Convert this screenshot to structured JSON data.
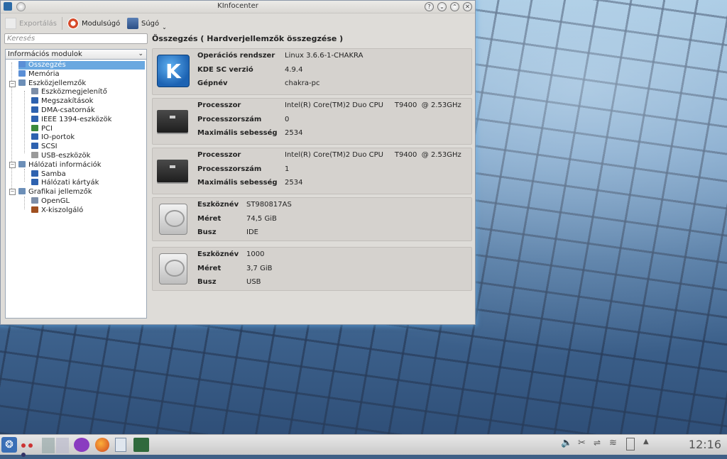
{
  "window": {
    "title": "KInfocenter"
  },
  "toolbar": {
    "export_label": "Exportálás",
    "module_help_label": "Modulsúgó",
    "help_label": "Súgó"
  },
  "search": {
    "placeholder": "Keresés"
  },
  "modules": {
    "combo_label": "Információs modulok",
    "items": [
      {
        "label": "Összegzés",
        "level": 1,
        "icon_color": "#5b8fd6"
      },
      {
        "label": "Memória",
        "level": 1,
        "icon_color": "#5b8fd6"
      },
      {
        "label": "Eszközjellemzők",
        "level": 1,
        "icon_color": "#6c8fb8"
      },
      {
        "label": "Eszközmegjelenítő",
        "level": 2,
        "icon_color": "#7d8ea8"
      },
      {
        "label": "Megszakítások",
        "level": 2,
        "icon_color": "#2e62b0"
      },
      {
        "label": "DMA-csatornák",
        "level": 2,
        "icon_color": "#2e62b0"
      },
      {
        "label": "IEEE 1394-eszközök",
        "level": 2,
        "icon_color": "#2e62b0"
      },
      {
        "label": "PCI",
        "level": 2,
        "icon_color": "#3c8a3c"
      },
      {
        "label": "IO-portok",
        "level": 2,
        "icon_color": "#2e62b0"
      },
      {
        "label": "SCSI",
        "level": 2,
        "icon_color": "#2e62b0"
      },
      {
        "label": "USB-eszközök",
        "level": 2,
        "icon_color": "#9a9a9a"
      },
      {
        "label": "Hálózati információk",
        "level": 1,
        "icon_color": "#6c8fb8"
      },
      {
        "label": "Samba",
        "level": 2,
        "icon_color": "#2e62b0"
      },
      {
        "label": "Hálózati kártyák",
        "level": 2,
        "icon_color": "#2e62b0"
      },
      {
        "label": "Grafikai jellemzők",
        "level": 1,
        "icon_color": "#6c8fb8"
      },
      {
        "label": "OpenGL",
        "level": 2,
        "icon_color": "#7d8ea8"
      },
      {
        "label": "X-kiszolgáló",
        "level": 2,
        "icon_color": "#a05020"
      }
    ]
  },
  "summary": {
    "heading": "Összegzés  ( Hardverjellemzők összegzése )",
    "sections": [
      {
        "icon": "kde-logo-icon",
        "rows": [
          {
            "label": "Operációs rendszer",
            "value": "Linux 3.6.6-1-CHAKRA"
          },
          {
            "label": "KDE SC verzió",
            "value": "4.9.4"
          },
          {
            "label": "Gépnév",
            "value": "chakra-pc"
          }
        ]
      },
      {
        "icon": "cpu-chip-icon",
        "rows": [
          {
            "label": "Processzor",
            "value": "Intel(R) Core(TM)2 Duo CPU     T9400  @ 2.53GHz"
          },
          {
            "label": "Processzorszám",
            "value": "0"
          },
          {
            "label": "Maximális sebesség",
            "value": "2534"
          }
        ]
      },
      {
        "icon": "cpu-chip-icon",
        "rows": [
          {
            "label": "Processzor",
            "value": "Intel(R) Core(TM)2 Duo CPU     T9400  @ 2.53GHz"
          },
          {
            "label": "Processzorszám",
            "value": "1"
          },
          {
            "label": "Maximális sebesség",
            "value": "2534"
          }
        ]
      },
      {
        "icon": "hard-disk-icon",
        "rows": [
          {
            "label": "Eszköznév",
            "value": "ST980817AS"
          },
          {
            "label": "Méret",
            "value": "74,5 GiB"
          },
          {
            "label": "Busz",
            "value": "IDE"
          }
        ]
      },
      {
        "icon": "hard-disk-icon",
        "rows": [
          {
            "label": "Eszköznév",
            "value": "1000"
          },
          {
            "label": "Méret",
            "value": "3,7 GiB"
          },
          {
            "label": "Busz",
            "value": "USB"
          }
        ]
      }
    ]
  },
  "taskbar": {
    "clock": "12:16"
  }
}
